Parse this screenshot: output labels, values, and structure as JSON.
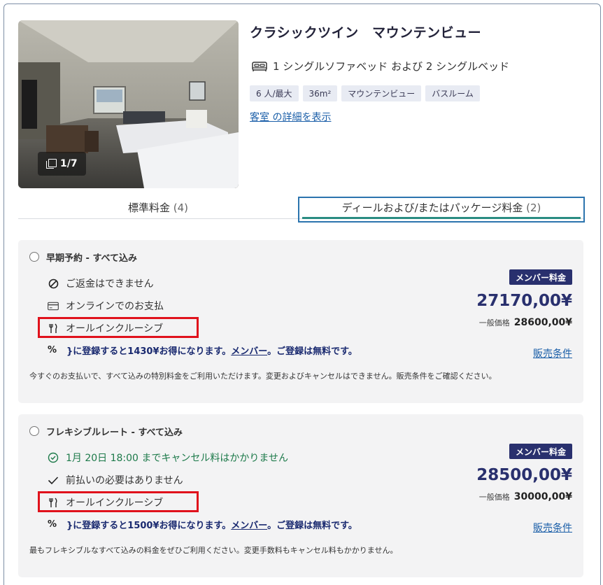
{
  "room": {
    "title": "クラシックツイン　マウンテンビュー",
    "photo_counter": "1/7",
    "beds": "1 シングルソファベッド および 2 シングルベッド",
    "tags": [
      "6 人/最大",
      "36m²",
      "マウンテンビュー",
      "バスルーム"
    ],
    "details_link": "客室 の詳細を表示"
  },
  "tabs": {
    "standard_label": "標準料金",
    "standard_count": "(4)",
    "deals_label": "ディールおよび/またはパッケージ料金",
    "deals_count": "(2)"
  },
  "rates": [
    {
      "name": "早期予約 - すべて込み",
      "features": [
        {
          "icon": "no-entry-icon",
          "text": "ご返金はできません"
        },
        {
          "icon": "credit-card-icon",
          "text": "オンラインでのお支払"
        },
        {
          "icon": "fork-knife-icon",
          "text": "オールインクルーシブ"
        }
      ],
      "promo_pre": "}に登録すると1430¥お得になります。",
      "promo_link": "メンバー",
      "promo_post": "。ご登録は無料です。",
      "description": "今すぐのお支払いで、すべて込みの特別料金をご利用いただけます。変更およびキャンセルはできません。販売条件をご確認ください。",
      "badge": "メンバー料金",
      "member_price": "27170,00¥",
      "general_label": "一般価格",
      "general_price": "28600,00¥",
      "terms": "販売条件"
    },
    {
      "name": "フレキシブルレート - すべて込み",
      "features": [
        {
          "icon": "clock-check-icon",
          "text": "1月 20日 18:00 までキャンセル料はかかりません"
        },
        {
          "icon": "checkmark-icon",
          "text": "前払いの必要はありません"
        },
        {
          "icon": "fork-knife-icon",
          "text": "オールインクルーシブ"
        }
      ],
      "promo_pre": "}に登録すると1500¥お得になります。",
      "promo_link": "メンバー",
      "promo_post": "。ご登録は無料です。",
      "description": "最もフレキシブルなすべて込みの料金をぜひご利用ください。変更手数料もキャンセル料もかかりません。",
      "badge": "メンバー料金",
      "member_price": "28500,00¥",
      "general_label": "一般価格",
      "general_price": "30000,00¥",
      "terms": "販売条件"
    }
  ],
  "colors": {
    "brand_navy": "#29306e",
    "link_blue": "#1a5ea8",
    "green": "#1d7a4a",
    "highlight_red": "#e0121c",
    "tab_teal": "#2a8c82"
  }
}
